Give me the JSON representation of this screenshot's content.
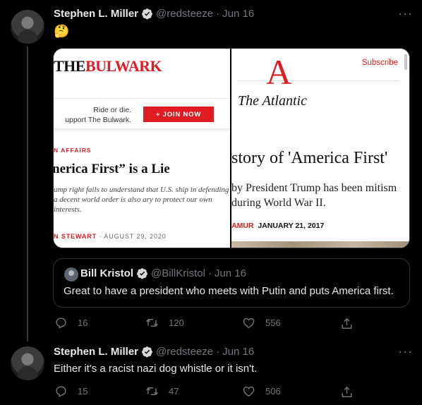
{
  "tweet1": {
    "name": "Stephen L. Miller",
    "handle": "@redsteeze",
    "separator": "·",
    "date": "Jun 16",
    "text": "🤔",
    "more": "···"
  },
  "media": {
    "left": {
      "logo_the": "THE",
      "logo_name": "BULWARK",
      "promo_line1": "Ride or die.",
      "promo_line2": "upport The Bulwark.",
      "join_label": "+ JOIN NOW",
      "section": "N AFFAIRS",
      "headline": "nerica First” is a Lie",
      "dek": "ump right fails to understand that U.S. ship in defending a decent world order is also ary to protect our own interests.",
      "byline_author": "N STEWART",
      "byline_rest": " · AUGUST 29, 2020"
    },
    "right": {
      "subscribe": "Subscribe",
      "logo_mark": "A",
      "title": "The Atlantic",
      "headline": "story of 'America First'",
      "dek": "by President Trump has been mitism during World War II.",
      "byline_author": "AMUR",
      "byline_date": "JANUARY 21, 2017"
    }
  },
  "quote": {
    "name": "Bill Kristol",
    "handle": "@BillKristol",
    "separator": "·",
    "date": "Jun 16",
    "text": "Great to have a president who meets with Putin and puts America first."
  },
  "tweet1_actions": {
    "replies": "16",
    "retweets": "120",
    "likes": "556"
  },
  "tweet2": {
    "name": "Stephen L. Miller",
    "handle": "@redsteeze",
    "separator": "·",
    "date": "Jun 16",
    "text": "Either it's a racist nazi dog whistle or it isn't.",
    "more": "···"
  },
  "tweet2_actions": {
    "replies": "15",
    "retweets": "47",
    "likes": "506"
  },
  "colors": {
    "background": "#000000",
    "muted": "#71767b",
    "text": "#e7e9ea",
    "bulwark_red": "#e01b22",
    "atlantic_red": "#e01b22"
  },
  "icons": [
    "verified-badge-icon",
    "more-icon",
    "reply-icon",
    "retweet-icon",
    "like-icon",
    "share-icon"
  ]
}
